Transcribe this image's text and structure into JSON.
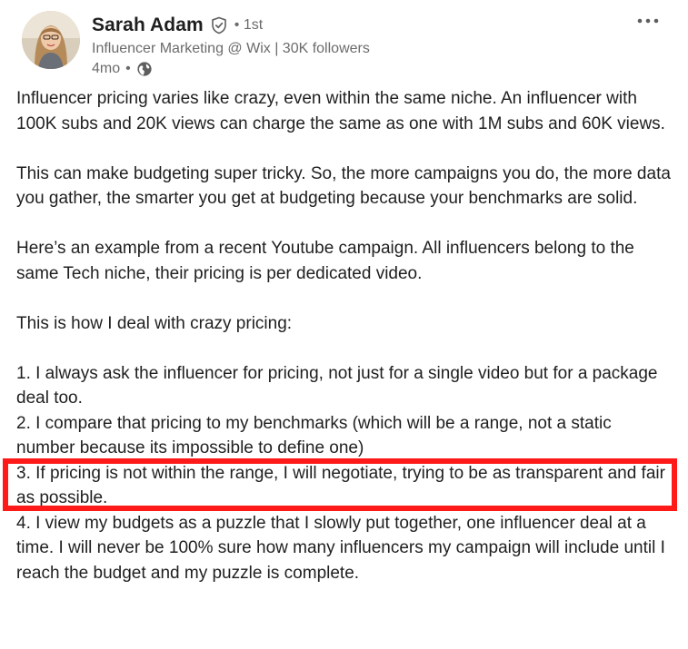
{
  "post": {
    "author": {
      "name": "Sarah Adam",
      "degree": "1st",
      "headline": "Influencer Marketing @ Wix | 30K followers",
      "age": "4mo",
      "avatar": "avatar-photo"
    },
    "icons": {
      "verified": "shield-check-icon",
      "visibility": "globe-icon",
      "more": "more-horizontal-icon"
    },
    "separator": "•",
    "paragraphs": [
      "Influencer pricing varies like crazy, even within the same niche. An influencer with 100K subs and 20K views can charge the same as one with 1M subs and 60K views.",
      "This can make budgeting super tricky. So, the more campaigns you do, the more data you gather, the smarter you get at budgeting because your benchmarks are solid.",
      "Here’s an example from a recent Youtube campaign. All influencers belong to the same Tech niche, their pricing is per dedicated video.",
      "This is how I deal with crazy pricing:"
    ],
    "list_items": [
      "1. I always ask the influencer for pricing, not just for a single video but for a package deal too.",
      "2. I compare that pricing to my benchmarks (which will be a range, not a static number because its impossible to define one)",
      "3. If pricing is not within the range, I will negotiate, trying to be as transparent and fair as possible.",
      "4. I view my budgets as a puzzle that I slowly put together, one influencer deal at a time. I will never be 100% sure how many influencers my campaign will include until I reach the budget and my puzzle is complete."
    ],
    "highlight_color": "#ff1a1a"
  }
}
